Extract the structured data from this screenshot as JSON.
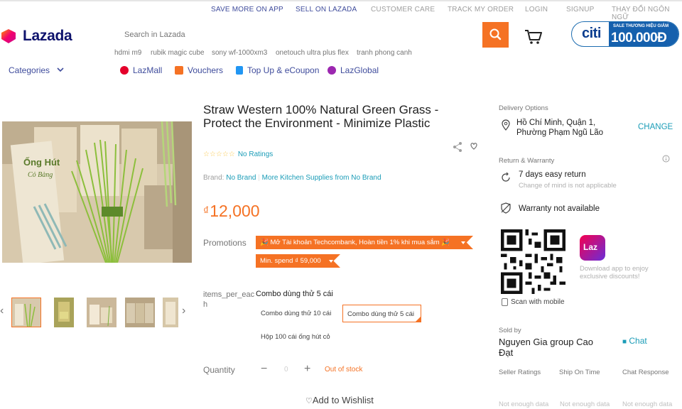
{
  "topbar": {
    "save_more": "SAVE MORE ON APP",
    "sell": "SELL ON LAZADA",
    "care": "CUSTOMER CARE",
    "track": "TRACK MY ORDER",
    "login": "LOGIN",
    "signup": "SIGNUP",
    "lang": "THAY ĐỔI NGÔN NGỮ"
  },
  "header": {
    "logo": "Lazada",
    "search_placeholder": "Search in Lazada",
    "banner": {
      "brand": "citi",
      "tagline": "SALE THƯƠNG HIỆU GIẢM",
      "amount": "100.000Đ"
    }
  },
  "keywords": [
    "hdmi m9",
    "rubik magic cube",
    "sony wf-1000xm3",
    "onetouch ultra plus flex",
    "tranh phong canh"
  ],
  "nav": {
    "categories": "Categories",
    "links": [
      "LazMall",
      "Vouchers",
      "Top Up & eCoupon",
      "LazGlobal"
    ]
  },
  "product": {
    "title": "Straw Western 100% Natural Green Grass - Protect the Environment - Minimize Plastic",
    "ratings": "No Ratings",
    "brand_label": "Brand:",
    "brand": "No Brand",
    "more": "More Kitchen Supplies from No Brand",
    "currency": "₫",
    "price": "12,000",
    "promotions_label": "Promotions",
    "promo1": "🎉 Mở Tài khoản Techcombank, Hoàn tiền 1% khi mua sắm 🎉",
    "promo2": "Min. spend ₫ 59,000",
    "variant_label": "items_per_each",
    "variant_selected": "Combo dùng thử 5 cái",
    "variants": [
      "Combo dùng thử 10 cái",
      "Combo dùng thử 5 cái",
      "Hộp 100 cái ống hút cỏ"
    ],
    "quantity_label": "Quantity",
    "quantity": "0",
    "stock": "Out of stock",
    "wishlist": "Add to Wishlist",
    "image_text_1": "Ống Hút",
    "image_text_2": "Cỏ Bàng"
  },
  "sidebar": {
    "delivery_label": "Delivery Options",
    "location": "Hồ Chí Minh, Quận 1, Phường Phạm Ngũ Lão",
    "change": "CHANGE",
    "return_label": "Return & Warranty",
    "return_title": "7 days easy return",
    "return_sub": "Change of mind is not applicable",
    "warranty": "Warranty not available",
    "app_icon": "Laz",
    "download": "Download app to enjoy exclusive discounts!",
    "scan": "Scan with mobile",
    "sold_by": "Sold by",
    "seller": "Nguyen Gia group Cao Đạt",
    "chat": "Chat",
    "seller_ratings": "Seller Ratings",
    "ship_on_time": "Ship On Time",
    "chat_response": "Chat Response",
    "not_enough": "Not enough data"
  },
  "colors": {
    "accent": "#f57224",
    "link": "#1a9cb7",
    "nav": "#3f4c9c"
  }
}
